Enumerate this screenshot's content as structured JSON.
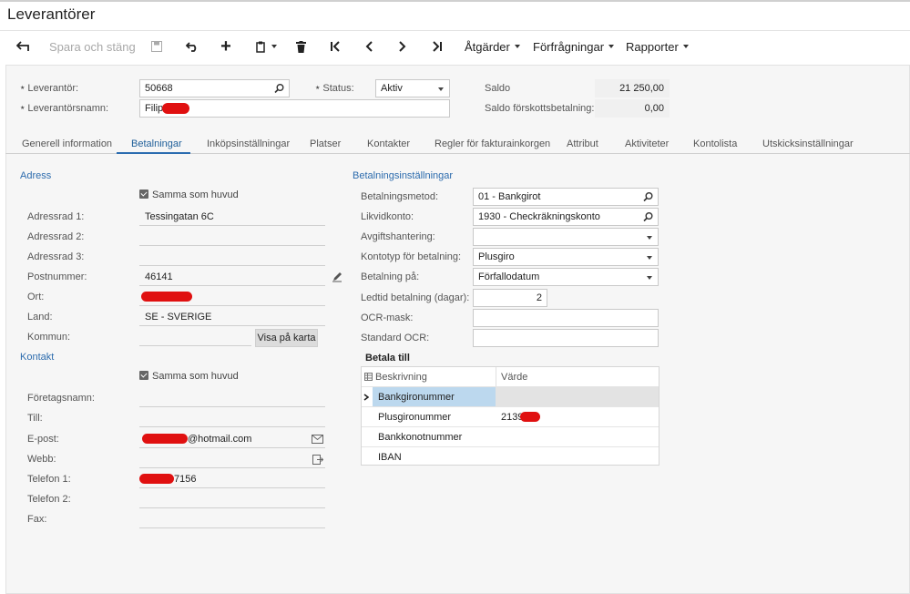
{
  "page": {
    "title": "Leverantörer"
  },
  "toolbar": {
    "back": "↩",
    "save_close": "Spara och stäng",
    "undo": "↶",
    "add": "+",
    "first": "|<",
    "prev": "<",
    "next": ">",
    "last": ">|",
    "actions": "Åtgärder",
    "inquiries": "Förfrågningar",
    "reports": "Rapporter"
  },
  "header": {
    "vendor_label": "Leverantör:",
    "vendor_value": "50668",
    "status_label": "Status:",
    "status_value": "Aktiv",
    "balance_label": "Saldo",
    "balance_value": "21 250,00",
    "vendor_name_label": "Leverantörsnamn:",
    "vendor_name_value": "Filip",
    "prepayment_label": "Saldo förskottsbetalning:",
    "prepayment_value": "0,00"
  },
  "tabs": [
    "Generell information",
    "Betalningar",
    "Inköpsinställningar",
    "Platser",
    "Kontakter",
    "Regler för fakturainkorgen",
    "Attribut",
    "Aktiviteter",
    "Kontolista",
    "Utskicksinställningar"
  ],
  "address": {
    "section": "Adress",
    "same_as_main": "Samma som huvud",
    "line1_label": "Adressrad 1:",
    "line1_value": "Tessingatan 6C",
    "line2_label": "Adressrad 2:",
    "line3_label": "Adressrad 3:",
    "postal_label": "Postnummer:",
    "postal_value": "46141",
    "city_label": "Ort:",
    "country_label": "Land:",
    "country_value": "SE - SVERIGE",
    "municipality_label": "Kommun:",
    "map_button": "Visa på karta"
  },
  "contact": {
    "section": "Kontakt",
    "same_as_main": "Samma som huvud",
    "company_label": "Företagsnamn:",
    "attention_label": "Till:",
    "email_label": "E-post:",
    "email_value": "@hotmail.com",
    "web_label": "Webb:",
    "phone1_label": "Telefon 1:",
    "phone1_value": "7156",
    "phone2_label": "Telefon 2:",
    "fax_label": "Fax:"
  },
  "payment": {
    "section": "Betalningsinställningar",
    "method_label": "Betalningsmetod:",
    "method_value": "01 - Bankgirot",
    "cash_account_label": "Likvidkonto:",
    "cash_account_value": "1930 - Checkräkningskonto",
    "charges_label": "Avgiftshantering:",
    "charges_value": "",
    "account_type_label": "Kontotyp för betalning:",
    "account_type_value": "Plusgiro",
    "pay_by_label": "Betalning på:",
    "pay_by_value": "Förfallodatum",
    "lead_time_label": "Ledtid betalning (dagar):",
    "lead_time_value": "2",
    "ocr_mask_label": "OCR-mask:",
    "standard_ocr_label": "Standard OCR:"
  },
  "pay_to": {
    "title": "Betala till",
    "col_description": "Beskrivning",
    "col_value": "Värde",
    "rows": [
      {
        "description": "Bankgironummer",
        "value": ""
      },
      {
        "description": "Plusgironummer",
        "value": "2139"
      },
      {
        "description": "Bankkonotnummer",
        "value": ""
      },
      {
        "description": "IBAN",
        "value": ""
      }
    ]
  }
}
